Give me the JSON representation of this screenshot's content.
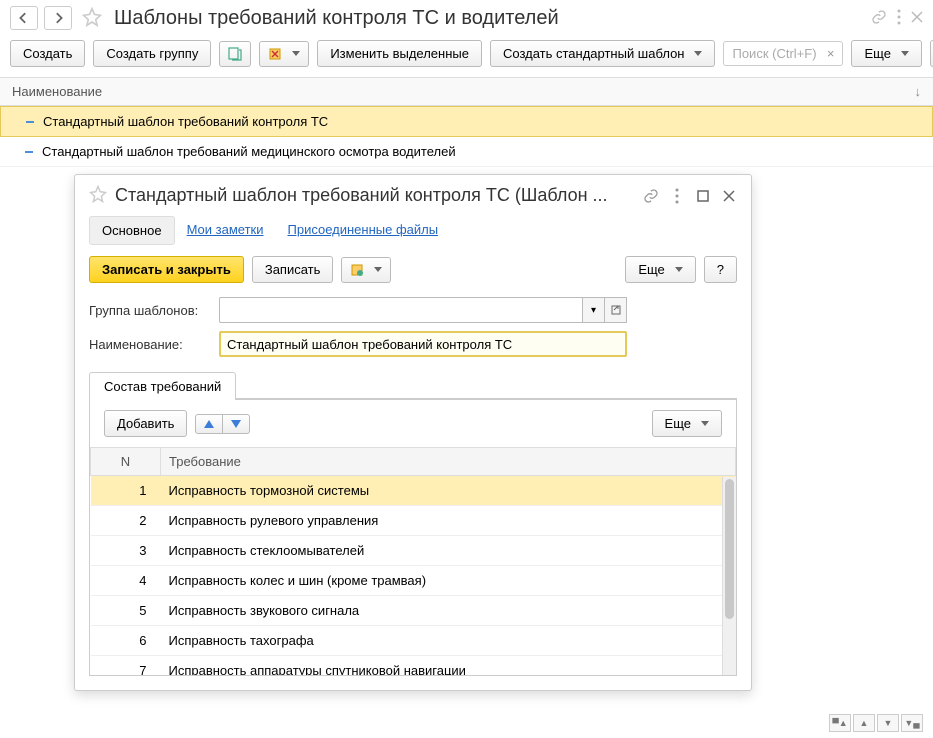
{
  "page": {
    "title": "Шаблоны требований контроля ТС и водителей"
  },
  "toolbar": {
    "create": "Создать",
    "create_group": "Создать группу",
    "edit_selected": "Изменить выделенные",
    "create_std": "Создать стандартный шаблон",
    "search_placeholder": "Поиск (Ctrl+F)",
    "more": "Еще",
    "help": "?"
  },
  "list": {
    "header": "Наименование",
    "rows": [
      {
        "text": "Стандартный шаблон требований контроля ТС",
        "selected": true
      },
      {
        "text": "Стандартный шаблон требований медицинского осмотра водителей",
        "selected": false
      }
    ]
  },
  "dialog": {
    "title": "Стандартный шаблон требований контроля ТС (Шаблон ...",
    "nav": {
      "main": "Основное",
      "notes": "Мои заметки",
      "attach": "Присоединенные файлы"
    },
    "toolbar": {
      "save_close": "Записать и закрыть",
      "save": "Записать",
      "more": "Еще",
      "help": "?"
    },
    "form": {
      "group_label": "Группа шаблонов:",
      "group_value": "",
      "name_label": "Наименование:",
      "name_value": "Стандартный шаблон требований контроля ТС"
    },
    "tab": {
      "composition": "Состав требований"
    },
    "table_toolbar": {
      "add": "Добавить",
      "more": "Еще"
    },
    "table": {
      "col_n": "N",
      "col_req": "Требование",
      "rows": [
        {
          "n": "1",
          "req": "Исправность тормозной системы",
          "sel": true
        },
        {
          "n": "2",
          "req": "Исправность рулевого управления",
          "sel": false
        },
        {
          "n": "3",
          "req": "Исправность стеклоомывателей",
          "sel": false
        },
        {
          "n": "4",
          "req": "Исправность колес и шин (кроме трамвая)",
          "sel": false
        },
        {
          "n": "5",
          "req": "Исправность звукового сигнала",
          "sel": false
        },
        {
          "n": "6",
          "req": "Исправность тахографа",
          "sel": false
        },
        {
          "n": "7",
          "req": "Исправность аппаратуры спутниковой навигации",
          "sel": false
        }
      ]
    }
  }
}
